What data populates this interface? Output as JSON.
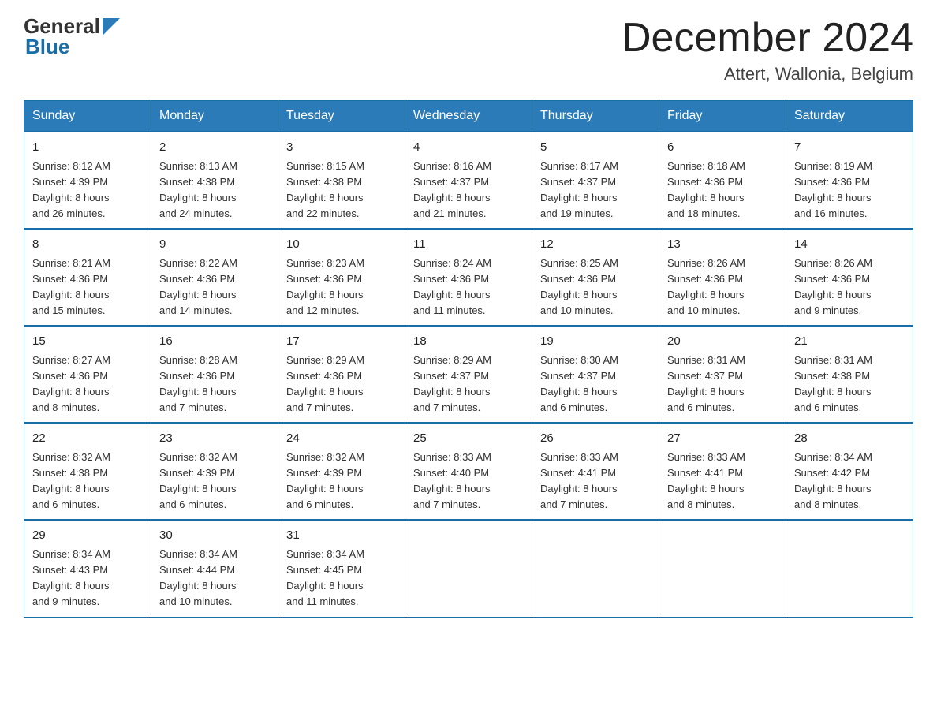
{
  "logo": {
    "general": "General",
    "blue": "Blue"
  },
  "title": {
    "main": "December 2024",
    "sub": "Attert, Wallonia, Belgium"
  },
  "days_of_week": [
    "Sunday",
    "Monday",
    "Tuesday",
    "Wednesday",
    "Thursday",
    "Friday",
    "Saturday"
  ],
  "weeks": [
    [
      {
        "day": "1",
        "sunrise": "8:12 AM",
        "sunset": "4:39 PM",
        "daylight": "8 hours and 26 minutes."
      },
      {
        "day": "2",
        "sunrise": "8:13 AM",
        "sunset": "4:38 PM",
        "daylight": "8 hours and 24 minutes."
      },
      {
        "day": "3",
        "sunrise": "8:15 AM",
        "sunset": "4:38 PM",
        "daylight": "8 hours and 22 minutes."
      },
      {
        "day": "4",
        "sunrise": "8:16 AM",
        "sunset": "4:37 PM",
        "daylight": "8 hours and 21 minutes."
      },
      {
        "day": "5",
        "sunrise": "8:17 AM",
        "sunset": "4:37 PM",
        "daylight": "8 hours and 19 minutes."
      },
      {
        "day": "6",
        "sunrise": "8:18 AM",
        "sunset": "4:36 PM",
        "daylight": "8 hours and 18 minutes."
      },
      {
        "day": "7",
        "sunrise": "8:19 AM",
        "sunset": "4:36 PM",
        "daylight": "8 hours and 16 minutes."
      }
    ],
    [
      {
        "day": "8",
        "sunrise": "8:21 AM",
        "sunset": "4:36 PM",
        "daylight": "8 hours and 15 minutes."
      },
      {
        "day": "9",
        "sunrise": "8:22 AM",
        "sunset": "4:36 PM",
        "daylight": "8 hours and 14 minutes."
      },
      {
        "day": "10",
        "sunrise": "8:23 AM",
        "sunset": "4:36 PM",
        "daylight": "8 hours and 12 minutes."
      },
      {
        "day": "11",
        "sunrise": "8:24 AM",
        "sunset": "4:36 PM",
        "daylight": "8 hours and 11 minutes."
      },
      {
        "day": "12",
        "sunrise": "8:25 AM",
        "sunset": "4:36 PM",
        "daylight": "8 hours and 10 minutes."
      },
      {
        "day": "13",
        "sunrise": "8:26 AM",
        "sunset": "4:36 PM",
        "daylight": "8 hours and 10 minutes."
      },
      {
        "day": "14",
        "sunrise": "8:26 AM",
        "sunset": "4:36 PM",
        "daylight": "8 hours and 9 minutes."
      }
    ],
    [
      {
        "day": "15",
        "sunrise": "8:27 AM",
        "sunset": "4:36 PM",
        "daylight": "8 hours and 8 minutes."
      },
      {
        "day": "16",
        "sunrise": "8:28 AM",
        "sunset": "4:36 PM",
        "daylight": "8 hours and 7 minutes."
      },
      {
        "day": "17",
        "sunrise": "8:29 AM",
        "sunset": "4:36 PM",
        "daylight": "8 hours and 7 minutes."
      },
      {
        "day": "18",
        "sunrise": "8:29 AM",
        "sunset": "4:37 PM",
        "daylight": "8 hours and 7 minutes."
      },
      {
        "day": "19",
        "sunrise": "8:30 AM",
        "sunset": "4:37 PM",
        "daylight": "8 hours and 6 minutes."
      },
      {
        "day": "20",
        "sunrise": "8:31 AM",
        "sunset": "4:37 PM",
        "daylight": "8 hours and 6 minutes."
      },
      {
        "day": "21",
        "sunrise": "8:31 AM",
        "sunset": "4:38 PM",
        "daylight": "8 hours and 6 minutes."
      }
    ],
    [
      {
        "day": "22",
        "sunrise": "8:32 AM",
        "sunset": "4:38 PM",
        "daylight": "8 hours and 6 minutes."
      },
      {
        "day": "23",
        "sunrise": "8:32 AM",
        "sunset": "4:39 PM",
        "daylight": "8 hours and 6 minutes."
      },
      {
        "day": "24",
        "sunrise": "8:32 AM",
        "sunset": "4:39 PM",
        "daylight": "8 hours and 6 minutes."
      },
      {
        "day": "25",
        "sunrise": "8:33 AM",
        "sunset": "4:40 PM",
        "daylight": "8 hours and 7 minutes."
      },
      {
        "day": "26",
        "sunrise": "8:33 AM",
        "sunset": "4:41 PM",
        "daylight": "8 hours and 7 minutes."
      },
      {
        "day": "27",
        "sunrise": "8:33 AM",
        "sunset": "4:41 PM",
        "daylight": "8 hours and 8 minutes."
      },
      {
        "day": "28",
        "sunrise": "8:34 AM",
        "sunset": "4:42 PM",
        "daylight": "8 hours and 8 minutes."
      }
    ],
    [
      {
        "day": "29",
        "sunrise": "8:34 AM",
        "sunset": "4:43 PM",
        "daylight": "8 hours and 9 minutes."
      },
      {
        "day": "30",
        "sunrise": "8:34 AM",
        "sunset": "4:44 PM",
        "daylight": "8 hours and 10 minutes."
      },
      {
        "day": "31",
        "sunrise": "8:34 AM",
        "sunset": "4:45 PM",
        "daylight": "8 hours and 11 minutes."
      },
      null,
      null,
      null,
      null
    ]
  ],
  "labels": {
    "sunrise": "Sunrise:",
    "sunset": "Sunset:",
    "daylight": "Daylight:"
  }
}
